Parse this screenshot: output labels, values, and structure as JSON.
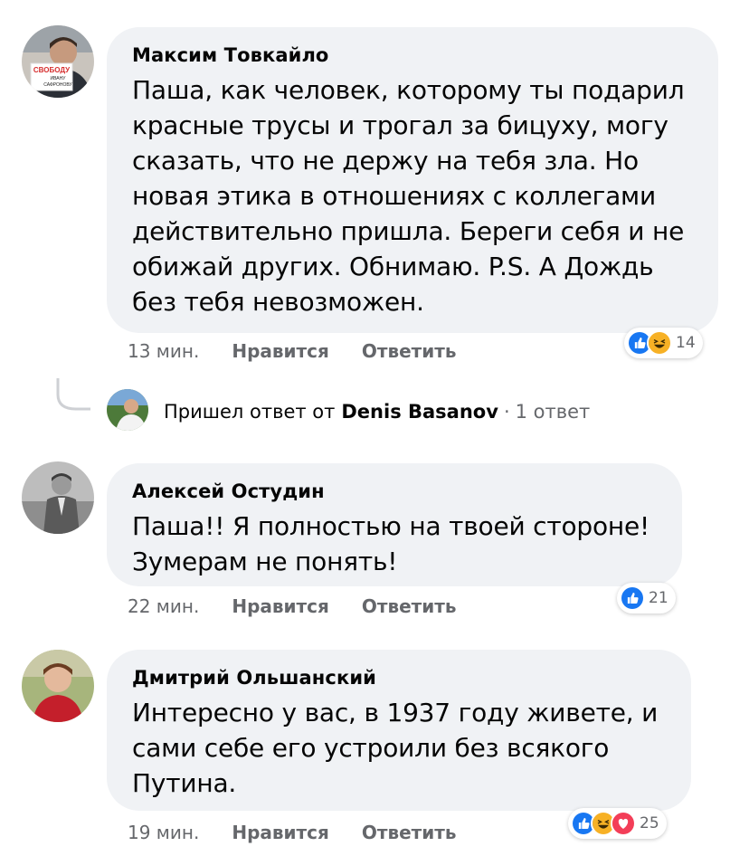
{
  "comments": [
    {
      "author": "Максим Товкайло",
      "text": "Паша, как человек, которому ты подарил красные трусы и трогал за бицуху, могу сказать, что не держу на тебя зла. Но новая этика в отношениях с коллегами действительно пришла. Береги себя и не обижай других. Обнимаю. P.S. А Дождь без тебя невозможен.",
      "time": "13 мин.",
      "like_label": "Нравится",
      "reply_label": "Ответить",
      "reactions": [
        "like-icon",
        "haha-icon"
      ],
      "reaction_count": "14",
      "avatar_sign": [
        "СВОБОДУ",
        "ИВАНУ",
        "САФРОНОВУ"
      ]
    },
    {
      "author": "Алексей Остудин",
      "text": "Паша!! Я полностью на твоей стороне! Зумерам не понять!",
      "time": "22 мин.",
      "like_label": "Нравится",
      "reply_label": "Ответить",
      "reactions": [
        "like-icon"
      ],
      "reaction_count": "21"
    },
    {
      "author": "Дмитрий Ольшанский",
      "text": "Интересно у вас, в 1937 году живете, и сами себе его устроили без всякого Путина.",
      "time": "19 мин.",
      "like_label": "Нравится",
      "reply_label": "Ответить",
      "reactions": [
        "like-icon",
        "haha-icon",
        "love-icon"
      ],
      "reaction_count": "25"
    }
  ],
  "reply_thread": {
    "prefix": "Пришел ответ от",
    "name": "Denis Basanov",
    "separator": "·",
    "count": "1 ответ"
  },
  "colors": {
    "bubble": "#f0f2f5",
    "secondary_text": "#65676b",
    "like_blue": "#1877f2",
    "haha_yellow": "#f7b125",
    "love_red": "#f33e58"
  }
}
